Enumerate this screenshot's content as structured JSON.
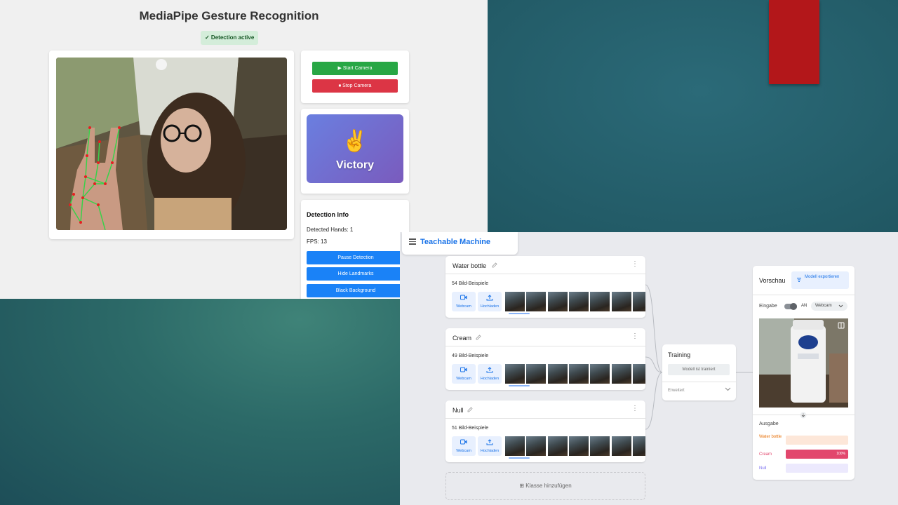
{
  "mediapipe": {
    "title": "MediaPipe Gesture Recognition",
    "status_badge": "✓ Detection active",
    "controls": {
      "start_label": "▶ Start Camera",
      "stop_label": "⏹ Stop Camera"
    },
    "gesture": {
      "emoji": "✌️",
      "name": "Victory"
    },
    "info": {
      "title": "Detection Info",
      "hands_line": "Detected Hands: 1",
      "fps_line": "FPS: 13",
      "pause_label": "Pause Detection",
      "landmarks_label": "Hide Landmarks",
      "background_label": "Black Background"
    }
  },
  "teachable": {
    "brand": "Teachable Machine",
    "classes": [
      {
        "name": "Water bottle",
        "samples": "54 Bild-Beispiele",
        "webcam_label": "Webcam",
        "upload_label": "Hochladen"
      },
      {
        "name": "Cream",
        "samples": "49 Bild-Beispiele",
        "webcam_label": "Webcam",
        "upload_label": "Hochladen"
      },
      {
        "name": "Null",
        "samples": "51 Bild-Beispiele",
        "webcam_label": "Webcam",
        "upload_label": "Hochladen"
      }
    ],
    "add_class_label": "Klasse hinzufügen",
    "training": {
      "title": "Training",
      "trained_label": "Modell ist trainiert",
      "advanced_label": "Erweitert"
    },
    "preview": {
      "title": "Vorschau",
      "export_label": "Modell exportieren",
      "input_label": "Eingabe",
      "toggle_label": "AN",
      "source_select": "Webcam",
      "output_label": "Ausgabe",
      "outputs": [
        {
          "name": "Water bottle",
          "percent": 0,
          "percent_label": "",
          "color": "#e8710a",
          "track": "#fde7d9"
        },
        {
          "name": "Cream",
          "percent": 100,
          "percent_label": "100%",
          "color": "#e2476d",
          "track": "#fbdbe3"
        },
        {
          "name": "Null",
          "percent": 0,
          "percent_label": "",
          "color": "#7b6ff0",
          "track": "#ece9fd"
        }
      ]
    }
  },
  "colors": {
    "start": "#28a745",
    "stop": "#dc3545",
    "primary": "#1a82f7",
    "tm_blue": "#1a73e8",
    "landmark_line": "#39d14a",
    "landmark_point": "#e62020"
  }
}
